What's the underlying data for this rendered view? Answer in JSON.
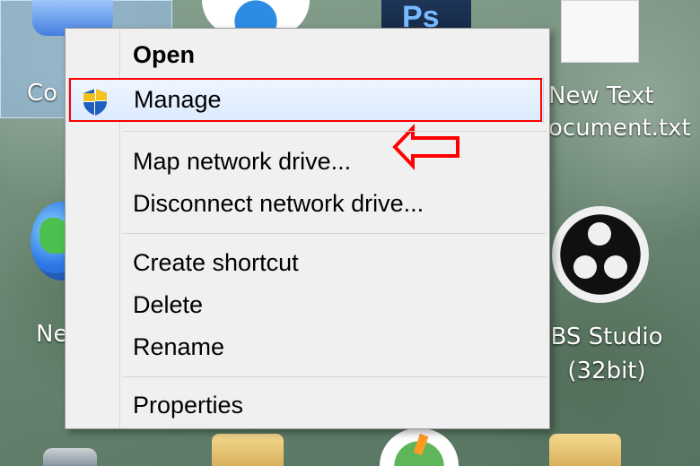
{
  "desktop": {
    "left_top_label": "Co",
    "left_bottom_label": "Ne",
    "right_top_label_line1": "New Text",
    "right_top_label_line2": "ocument.txt",
    "right_bottom_label_line1": "BS Studio",
    "right_bottom_label_line2": "(32bit)",
    "photoshop_text": "Ps"
  },
  "context_menu": {
    "items": [
      {
        "label": "Open"
      },
      {
        "label": "Manage"
      },
      {
        "label": "Map network drive..."
      },
      {
        "label": "Disconnect network drive..."
      },
      {
        "label": "Create shortcut"
      },
      {
        "label": "Delete"
      },
      {
        "label": "Rename"
      },
      {
        "label": "Properties"
      }
    ]
  },
  "colors": {
    "highlight": "#ff0000",
    "menu_background": "#f0f0f0"
  },
  "icons": {
    "manage": "shield-icon",
    "annotation": "left-arrow-icon",
    "desktop_obs": "obs-studio-icon"
  }
}
